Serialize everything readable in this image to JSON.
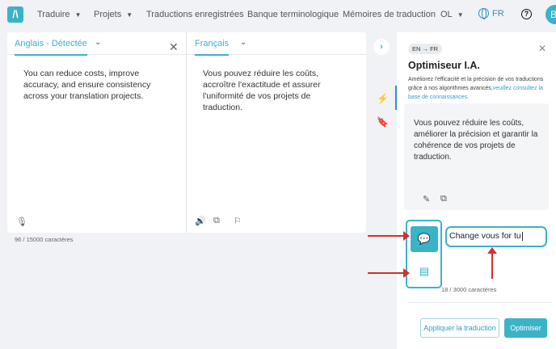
{
  "nav": {
    "logo": "/\\",
    "items": [
      {
        "label": "Traduire",
        "has_menu": true
      },
      {
        "label": "Projets",
        "has_menu": true
      },
      {
        "label": "Traductions enregistrées",
        "has_menu": false
      },
      {
        "label": "Banque terminologique",
        "has_menu": false
      },
      {
        "label": "Mémoires de traduction",
        "has_menu": false
      },
      {
        "label": "OL",
        "has_menu": true
      }
    ],
    "language": "FR",
    "avatar_initial": "B"
  },
  "source": {
    "language": "Anglais - Détectée",
    "text": "You can reduce costs, improve accuracy, and ensure consistency across your translation projects.",
    "char_count": "96 / 15000 caractères"
  },
  "target": {
    "language": "Français",
    "text": "Vous pouvez réduire les coûts, accroître l'exactitude et assurer l'uniformité de vos projets de traduction."
  },
  "optimizer": {
    "direction": "EN → FR",
    "title": "Optimiseur I.A.",
    "description": "Améliorez l'efficacité et la précision de vos traductions grâce à nos algorithmes avancés,",
    "link": "veuillez consultez la base de connaissances.",
    "result": "Vous pouvez réduire les coûts, améliorer la précision et garantir la cohérence de vos projets de traduction.",
    "instruction_value": "Change vous for tu",
    "instruction_count": "18 / 3000 caractères",
    "apply_label": "Appliquer la traduction",
    "optimize_label": "Optimiser"
  },
  "colors": {
    "accent": "#3ab3c7",
    "annotation": "#d32f2f"
  }
}
